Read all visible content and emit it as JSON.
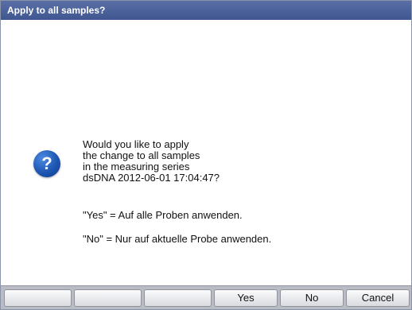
{
  "dialog": {
    "title": "Apply to all samples?",
    "icon": "question-icon",
    "icon_glyph": "?",
    "message_lines": [
      "Would you like to apply",
      "the change to all samples",
      "in the measuring series",
      "dsDNA 2012-06-01 17:04:47?"
    ],
    "option_yes": "\"Yes\" = Auf alle Proben anwenden.",
    "option_no": "\"No\"  = Nur auf aktuelle Probe anwenden."
  },
  "buttons": {
    "empty_1": "",
    "empty_2": "",
    "empty_3": "",
    "yes": "Yes",
    "no": "No",
    "cancel": "Cancel"
  },
  "colors": {
    "title_bar": "#4a5f9a",
    "footer": "#b9bcc4",
    "icon": "#1d56b3"
  }
}
